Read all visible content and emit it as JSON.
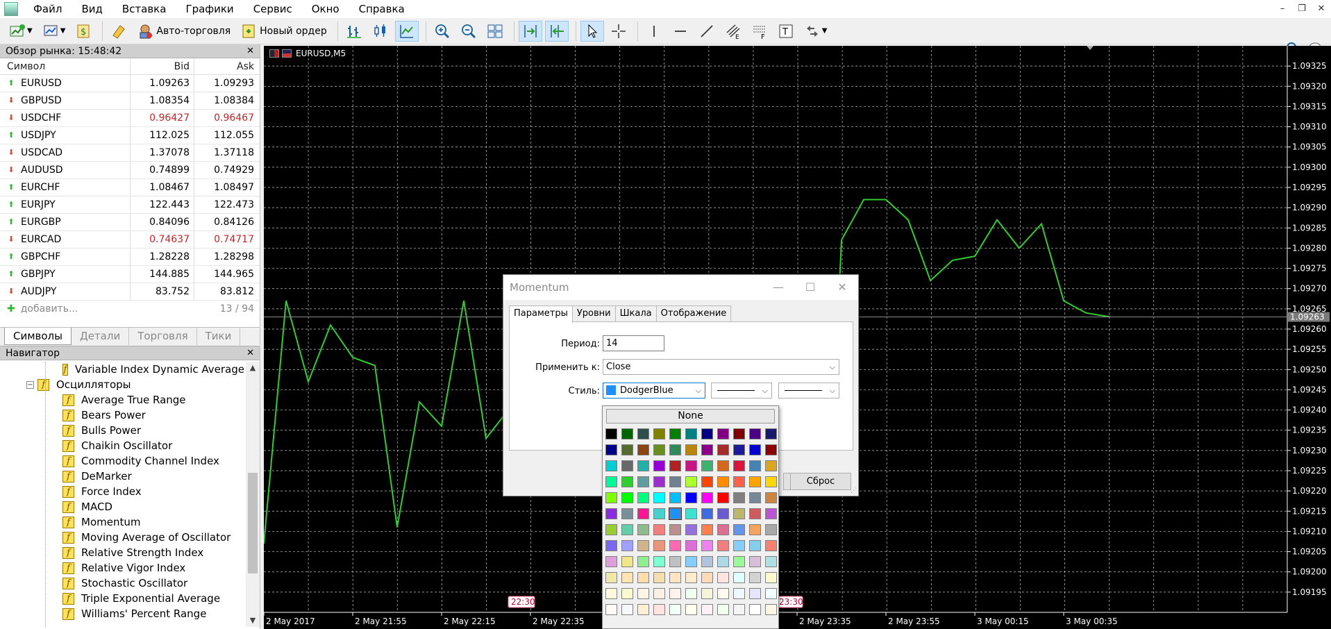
{
  "menu": [
    "Файл",
    "Вид",
    "Вставка",
    "Графики",
    "Сервис",
    "Окно",
    "Справка"
  ],
  "toolbar": {
    "auto_trading": "Авто-торговля",
    "new_order": "Новый ордер"
  },
  "market_watch": {
    "title": "Обзор рынка: 15:48:42",
    "columns": {
      "symbol": "Символ",
      "bid": "Bid",
      "ask": "Ask"
    },
    "rows": [
      {
        "symbol": "EURUSD",
        "bid": "1.09263",
        "ask": "1.09293",
        "dir": "up"
      },
      {
        "symbol": "GBPUSD",
        "bid": "1.08354",
        "ask": "1.08384",
        "dir": "down"
      },
      {
        "symbol": "USDCHF",
        "bid": "0.96427",
        "ask": "0.96467",
        "dir": "down"
      },
      {
        "symbol": "USDJPY",
        "bid": "112.025",
        "ask": "112.055",
        "dir": "up"
      },
      {
        "symbol": "USDCAD",
        "bid": "1.37078",
        "ask": "1.37118",
        "dir": "down"
      },
      {
        "symbol": "AUDUSD",
        "bid": "0.74899",
        "ask": "0.74929",
        "dir": "down"
      },
      {
        "symbol": "EURCHF",
        "bid": "1.08467",
        "ask": "1.08497",
        "dir": "up"
      },
      {
        "symbol": "EURJPY",
        "bid": "122.443",
        "ask": "122.473",
        "dir": "up"
      },
      {
        "symbol": "EURGBP",
        "bid": "0.84096",
        "ask": "0.84126",
        "dir": "up"
      },
      {
        "symbol": "EURCAD",
        "bid": "0.74637",
        "ask": "0.74717",
        "dir": "down"
      },
      {
        "symbol": "GBPCHF",
        "bid": "1.28228",
        "ask": "1.28298",
        "dir": "up"
      },
      {
        "symbol": "GBPJPY",
        "bid": "144.885",
        "ask": "144.965",
        "dir": "up"
      },
      {
        "symbol": "AUDJPY",
        "bid": "83.752",
        "ask": "83.812",
        "dir": "down"
      }
    ],
    "red_rows": [
      "USDCHF",
      "EURCAD"
    ],
    "add_label": "добавить...",
    "count": "13 / 94",
    "tabs": [
      "Символы",
      "Детали",
      "Торговля",
      "Тики"
    ]
  },
  "navigator": {
    "title": "Навигатор",
    "top_item": "Variable Index Dynamic Average",
    "folder": "Осцилляторы",
    "items": [
      "Average True Range",
      "Bears Power",
      "Bulls Power",
      "Chaikin Oscillator",
      "Commodity Channel Index",
      "DeMarker",
      "Force Index",
      "MACD",
      "Momentum",
      "Moving Average of Oscillator",
      "Relative Strength Index",
      "Relative Vigor Index",
      "Stochastic Oscillator",
      "Triple Exponential Average",
      "Williams' Percent Range"
    ]
  },
  "chart": {
    "symbol_label": "EURUSD,M5",
    "current_price": "1.09263",
    "time_label_left": "22:30",
    "time_label_right": "23:30"
  },
  "chart_data": {
    "type": "line",
    "x_labels": [
      "2 May 2017",
      "2 May 21:55",
      "2 May 22:15",
      "2 May 22:35",
      "2 May 23:35",
      "2 May 23:55",
      "3 May 00:15",
      "3 May 00:35"
    ],
    "y_ticks": [
      "1.09325",
      "1.09320",
      "1.09315",
      "1.09310",
      "1.09305",
      "1.09300",
      "1.09295",
      "1.09290",
      "1.09285",
      "1.09280",
      "1.09275",
      "1.09270",
      "1.09265",
      "1.09260",
      "1.09255",
      "1.09250",
      "1.09245",
      "1.09240",
      "1.09235",
      "1.09230",
      "1.09225",
      "1.09220",
      "1.09215",
      "1.09210",
      "1.09205",
      "1.09200",
      "1.09195"
    ],
    "ylim": [
      1.0919,
      1.0933
    ],
    "series_color": "#32cd32",
    "segments": [
      [
        1.09207,
        1.09267,
        1.09247,
        1.09261,
        1.09253,
        1.09251,
        1.09211,
        1.09242,
        1.09236,
        1.09267,
        1.09233,
        1.0924
      ],
      [
        1.09282,
        1.09292,
        1.09292,
        1.09287,
        1.09272,
        1.09277,
        1.09278,
        1.09287,
        1.0928,
        1.09286,
        1.09267,
        1.09264,
        1.09263
      ]
    ],
    "grid": true
  },
  "dialog": {
    "title": "Momentum",
    "tabs": [
      "Параметры",
      "Уровни",
      "Шкала",
      "Отображение"
    ],
    "period_label": "Период:",
    "period_value": "14",
    "apply_label": "Применить к:",
    "apply_value": "Close",
    "style_label": "Стиль:",
    "style_color_name": "DodgerBlue",
    "style_color": "#1e90ff",
    "reset_button": "Сброс"
  },
  "palette": {
    "none_label": "None",
    "colors": [
      [
        "#000000",
        "#006400",
        "#2f4f4f",
        "#808000",
        "#008000",
        "#008080",
        "#000080",
        "#800080",
        "#800000",
        "#4b0082",
        "#191970"
      ],
      [
        "#00008b",
        "#556b2f",
        "#8b4513",
        "#6b8e23",
        "#2e8b57",
        "#b8860b",
        "#8b008b",
        "#a52a2a",
        "#1c1c9a",
        "#0000cd",
        "#8b0000"
      ],
      [
        "#00ced1",
        "#696969",
        "#20b2aa",
        "#9400d3",
        "#b22222",
        "#c71585",
        "#3cb371",
        "#d2691e",
        "#dc143c",
        "#4682b4",
        "#daa520"
      ],
      [
        "#00fa9a",
        "#32cd32",
        "#5f9ea0",
        "#9932cc",
        "#708090",
        "#adff2f",
        "#ff4500",
        "#ff8c00",
        "#ff6347",
        "#ffa500",
        "#ffd700"
      ],
      [
        "#7fff00",
        "#00ff00",
        "#00ff7f",
        "#00ffff",
        "#00bfff",
        "#0000ff",
        "#ff00ff",
        "#ff0000",
        "#808080",
        "#778899",
        "#cd853f"
      ],
      [
        "#8a2be2",
        "#7b8f99",
        "#ff1493",
        "#48d1cc",
        "#1e90ff",
        "#40e0d0",
        "#4169e1",
        "#6a5acd",
        "#bdb76b",
        "#cd5c5c",
        "#ba55d3"
      ],
      [
        "#9acd32",
        "#66cdaa",
        "#8fbc8f",
        "#f08080",
        "#bc8f8f",
        "#9370db",
        "#ff7f50",
        "#db7093",
        "#6495ed",
        "#f4a460",
        "#a9a9a9"
      ],
      [
        "#7b68ee",
        "#a0a0ff",
        "#d2b48c",
        "#e9967a",
        "#ff69b4",
        "#da70d6",
        "#ee82ee",
        "#f08080",
        "#87cefa",
        "#87ceeb",
        "#fa8072"
      ],
      [
        "#dda0dd",
        "#f0e68c",
        "#90ee90",
        "#7fffd4",
        "#c0c0c0",
        "#87cefa",
        "#b0c4de",
        "#add8e6",
        "#98fb98",
        "#d8bfd8",
        "#b0e0e6"
      ],
      [
        "#eee8aa",
        "#ffe4b5",
        "#ffdead",
        "#f5deb3",
        "#ffe4c4",
        "#ffebcd",
        "#ffdab9",
        "#ffe4e1",
        "#e0ffff",
        "#d3d3d3",
        "#fffacd"
      ],
      [
        "#fff8dc",
        "#fafad2",
        "#fdf5e6",
        "#faf0e6",
        "#fff5ee",
        "#f0fff0",
        "#f5f5dc",
        "#fffaf0",
        "#f0f8ff",
        "#e6e6fa",
        "#f0ffff"
      ],
      [
        "#fffafa",
        "#f8f8ff",
        "#ffefd5",
        "#ffe4e1",
        "#f5fffa",
        "#fffff0",
        "#fff0f5",
        "#f0fff0",
        "#f5f5f5",
        "#ffffff",
        "#fdf5e6"
      ]
    ]
  }
}
